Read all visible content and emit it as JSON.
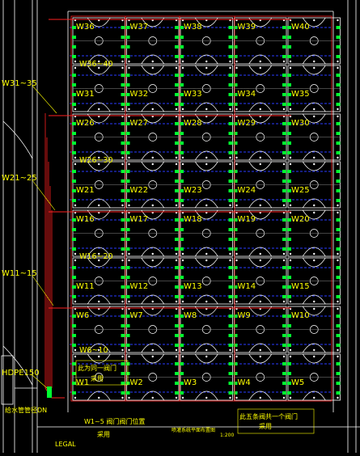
{
  "canvas": {
    "background": "#000000"
  },
  "colors": {
    "outline": "#ffffff",
    "court_line": "#ffffff",
    "pipe": "#ff2020",
    "lateral": "#2a3cff",
    "valve": "#00ff30",
    "text": "#ffff00",
    "grid_gray": "#888888"
  },
  "court_rows": [
    [
      "W36",
      "W37",
      "W38",
      "W39",
      "W40",
      "W31",
      "W32",
      "W33",
      "W34",
      "W35"
    ],
    [
      "W26",
      "W27",
      "W28",
      "W29",
      "W30",
      "W21",
      "W22",
      "W23",
      "W24",
      "W25"
    ],
    [
      "W16",
      "W17",
      "W18",
      "W19",
      "W20",
      "W11",
      "W12",
      "W13",
      "W14",
      "W15"
    ],
    [
      "W6",
      "W7",
      "W8",
      "W9",
      "W10",
      "W1",
      "W2",
      "W3",
      "W4",
      "W5"
    ]
  ],
  "zone_labels": [
    "W36~40",
    "W26~30",
    "W16~20",
    "W6~10"
  ],
  "side_labels": [
    "W31~35",
    "W21~25",
    "W11~15",
    "HDPE150"
  ],
  "notes": {
    "left_block_line1": "此为同一阀门",
    "left_block_line2": "采用",
    "right_block_line1": "此五条阀共一个阀门",
    "right_block_line2": "采用",
    "bottom_main": "W1~5 阀门阀门位置",
    "bottom_sub": "采用",
    "left_bottom": "给水管管径DN",
    "bottom_left_code": "LEGAL",
    "title": "喷灌系统平面布置图",
    "scale": "1:200"
  }
}
